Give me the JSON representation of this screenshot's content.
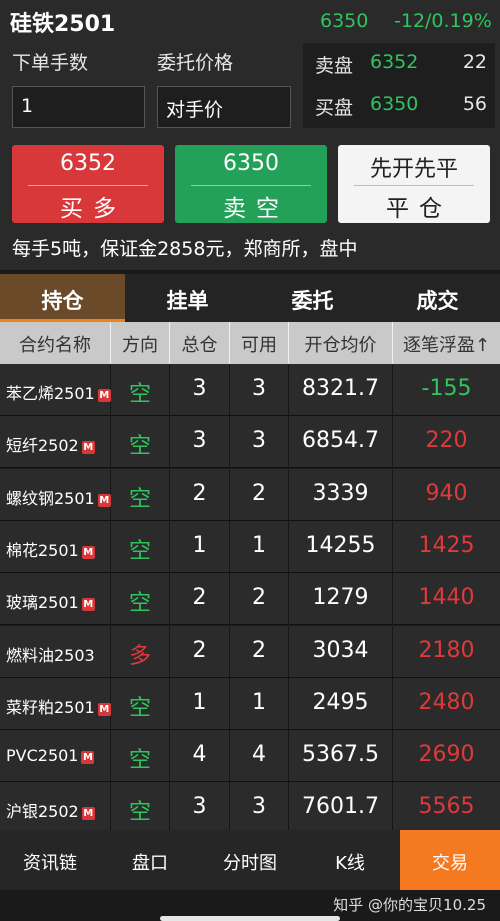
{
  "header": {
    "title": "硅铁2501",
    "last_price": "6350",
    "change": "-12/0.19%"
  },
  "order": {
    "qty_label": "下单手数",
    "qty_value": "1",
    "price_label": "委托价格",
    "price_value": "对手价"
  },
  "book": {
    "ask_label": "卖盘",
    "ask_price": "6352",
    "ask_volume": "22",
    "bid_label": "买盘",
    "bid_price": "6350",
    "bid_volume": "56"
  },
  "buttons": {
    "buy_price": "6352",
    "buy_label": "买多",
    "sell_price": "6350",
    "sell_label": "卖空",
    "close_mode": "先开先平",
    "close_label": "平仓"
  },
  "info_line": "每手5吨，保证金2858元，郑商所，盘中",
  "tabs": [
    {
      "label": "持仓"
    },
    {
      "label": "挂单"
    },
    {
      "label": "委托"
    },
    {
      "label": "成交"
    }
  ],
  "table": {
    "headers": [
      "合约名称",
      "方向",
      "总仓",
      "可用",
      "开仓均价",
      "逐笔浮盈↑"
    ],
    "badge": "M",
    "rows": [
      {
        "name": "苯乙烯2501",
        "badge": true,
        "direction": "空",
        "dir_color": "green",
        "total": "3",
        "available": "3",
        "avg_price": "8321.7",
        "pnl": "-155",
        "pnl_color": "green"
      },
      {
        "name": "短纤2502",
        "badge": true,
        "direction": "空",
        "dir_color": "green",
        "total": "3",
        "available": "3",
        "avg_price": "6854.7",
        "pnl": "220",
        "pnl_color": "red"
      },
      {
        "name": "螺纹钢2501",
        "badge": true,
        "direction": "空",
        "dir_color": "green",
        "total": "2",
        "available": "2",
        "avg_price": "3339",
        "pnl": "940",
        "pnl_color": "red"
      },
      {
        "name": "棉花2501",
        "badge": true,
        "direction": "空",
        "dir_color": "green",
        "total": "1",
        "available": "1",
        "avg_price": "14255",
        "pnl": "1425",
        "pnl_color": "red"
      },
      {
        "name": "玻璃2501",
        "badge": true,
        "direction": "空",
        "dir_color": "green",
        "total": "2",
        "available": "2",
        "avg_price": "1279",
        "pnl": "1440",
        "pnl_color": "red"
      },
      {
        "name": "燃料油2503",
        "badge": false,
        "direction": "多",
        "dir_color": "red",
        "total": "2",
        "available": "2",
        "avg_price": "3034",
        "pnl": "2180",
        "pnl_color": "red"
      },
      {
        "name": "菜籽粕2501",
        "badge": true,
        "direction": "空",
        "dir_color": "green",
        "total": "1",
        "available": "1",
        "avg_price": "2495",
        "pnl": "2480",
        "pnl_color": "red"
      },
      {
        "name": "PVC2501",
        "badge": true,
        "direction": "空",
        "dir_color": "green",
        "total": "4",
        "available": "4",
        "avg_price": "5367.5",
        "pnl": "2690",
        "pnl_color": "red"
      },
      {
        "name": "沪银2502",
        "badge": true,
        "direction": "空",
        "dir_color": "green",
        "total": "3",
        "available": "3",
        "avg_price": "7601.7",
        "pnl": "5565",
        "pnl_color": "red"
      }
    ]
  },
  "bottom_nav": [
    {
      "label": "资讯链"
    },
    {
      "label": "盘口"
    },
    {
      "label": "分时图"
    },
    {
      "label": "K线"
    },
    {
      "label": "交易"
    }
  ],
  "watermark": "知乎 @你的宝贝10.25",
  "colors": {
    "up": "#e0393b",
    "down": "#2ec45e",
    "accent": "#f47920"
  }
}
